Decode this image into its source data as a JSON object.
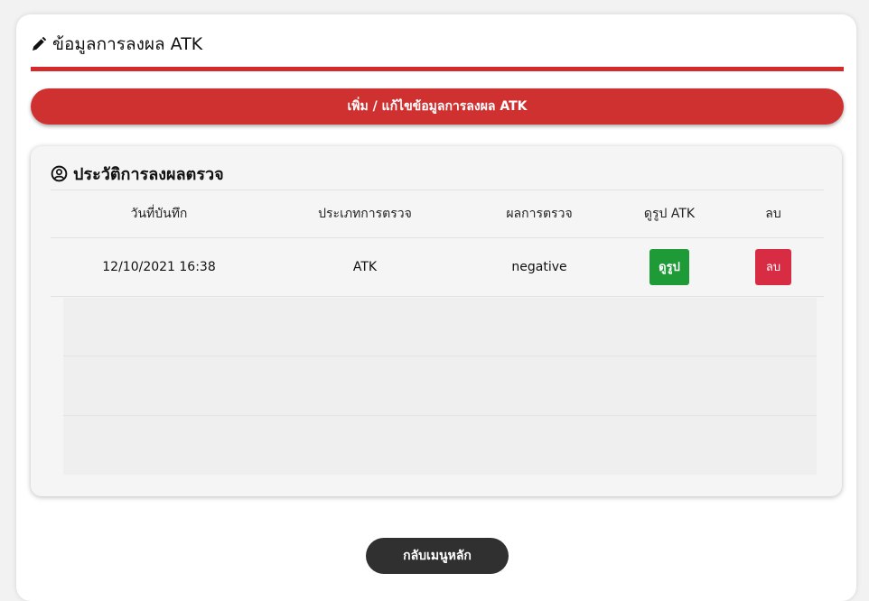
{
  "header": {
    "title": "ข้อมูลการลงผล ATK",
    "icon": "pencil-icon"
  },
  "actions": {
    "add_edit_label": "เพิ่ม / แก้ไขข้อมูลการลงผล ATK",
    "back_label": "กลับเมนูหลัก"
  },
  "history": {
    "title": "ประวัติการลงผลตรวจ",
    "icon": "user-circle-icon",
    "columns": [
      "วันที่บันทึก",
      "ประเภทการตรวจ",
      "ผลการตรวจ",
      "ดูรูป ATK",
      "ลบ"
    ],
    "rows": [
      {
        "date": "12/10/2021 16:38",
        "type": "ATK",
        "result": "negative",
        "view_label": "ดูรูป",
        "delete_label": "ลบ"
      }
    ]
  },
  "colors": {
    "accent_red": "#cf3131",
    "view_green": "#1e9a37",
    "delete_red": "#d72c43",
    "back_dark": "#303030"
  }
}
